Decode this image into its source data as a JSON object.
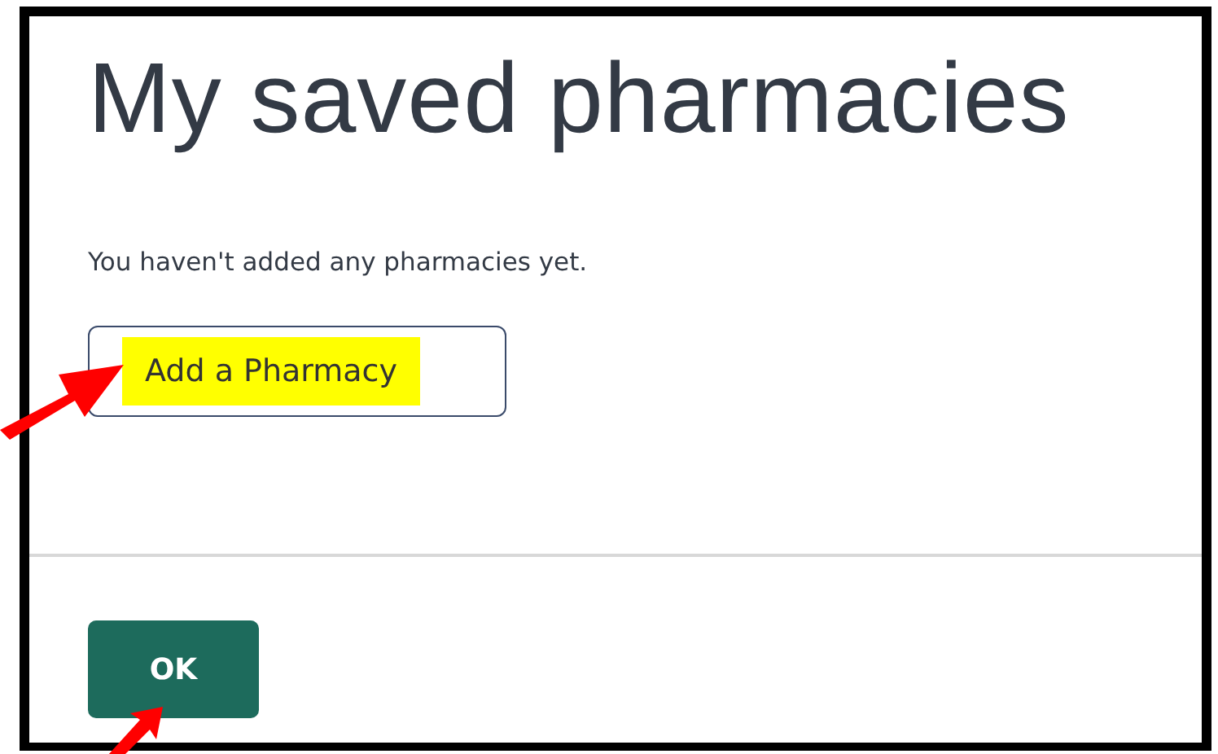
{
  "heading": "My saved pharmacies",
  "message": "You haven't added any pharmacies yet.",
  "add_button": {
    "label": "Add a Pharmacy",
    "highlighted": true
  },
  "ok_button": {
    "label": "OK"
  }
}
